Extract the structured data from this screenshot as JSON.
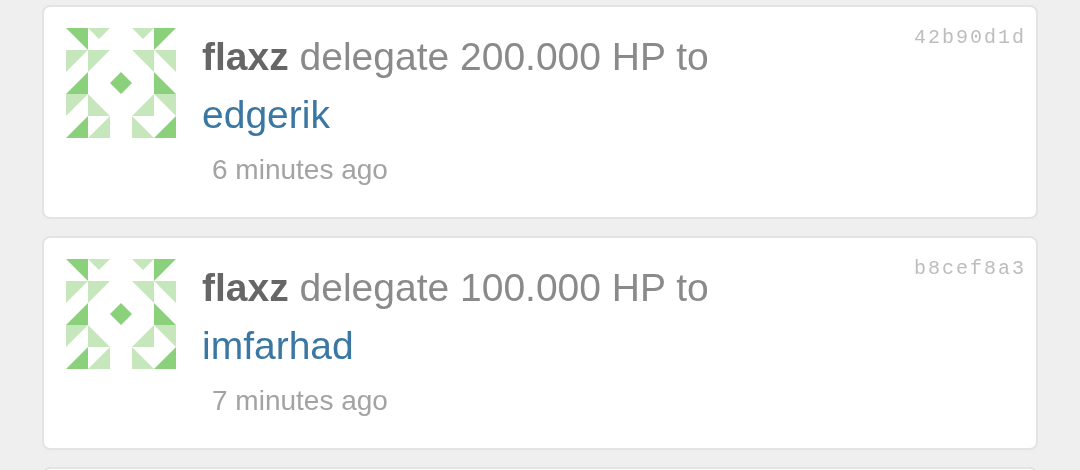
{
  "activities": [
    {
      "author": "flaxz",
      "action": "delegate 200.000 HP to",
      "recipient": "edgerik",
      "time": "6 minutes ago",
      "hash": "42b90d1d"
    },
    {
      "author": "flaxz",
      "action": "delegate 100.000 HP to",
      "recipient": "imfarhad",
      "time": "7 minutes ago",
      "hash": "b8cef8a3"
    }
  ]
}
